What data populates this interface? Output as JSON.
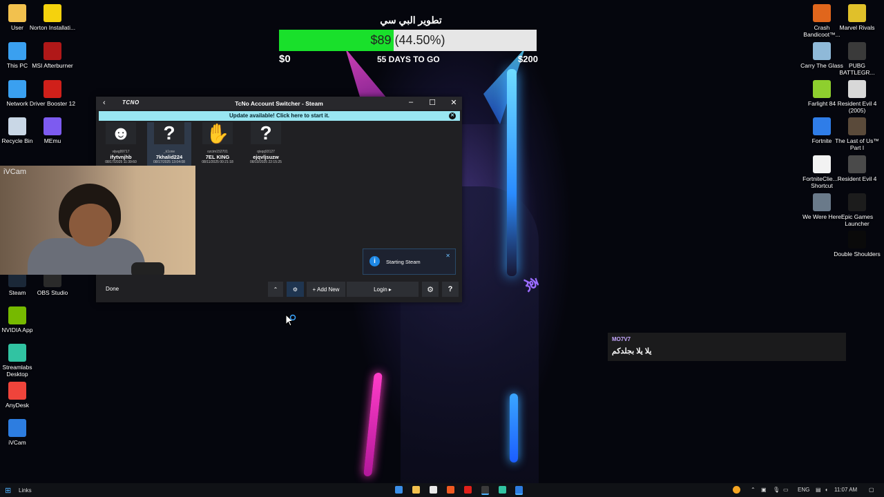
{
  "desktop_left": [
    {
      "label": "User",
      "icon": "folder-icon",
      "color": "#f2c14e"
    },
    {
      "label": "Norton Installati...",
      "icon": "norton-icon",
      "color": "#f5d20d"
    },
    {
      "label": "This PC",
      "icon": "monitor-icon",
      "color": "#3aa0f0"
    },
    {
      "label": "MSI Afterburner",
      "icon": "msi-afterburner-icon",
      "color": "#b01818"
    },
    {
      "label": "Network",
      "icon": "network-icon",
      "color": "#3aa0f0"
    },
    {
      "label": "Driver Booster 12",
      "icon": "driver-booster-icon",
      "color": "#d0201a"
    },
    {
      "label": "Recycle Bin",
      "icon": "recycle-bin-icon",
      "color": "#c9d7e6"
    },
    {
      "label": "MEmu",
      "icon": "memu-icon",
      "color": "#7d5bf0"
    },
    {
      "label": "Steam",
      "icon": "steam-icon",
      "color": "#1b2838"
    },
    {
      "label": "OBS Studio",
      "icon": "obs-icon",
      "color": "#2a2a2a"
    },
    {
      "label": "NVIDIA App",
      "icon": "nvidia-icon",
      "color": "#76b900"
    },
    {
      "label": "Streamlabs Desktop",
      "icon": "streamlabs-icon",
      "color": "#31c3a2"
    },
    {
      "label": "AnyDesk",
      "icon": "anydesk-icon",
      "color": "#ef443b"
    },
    {
      "label": "iVCam",
      "icon": "ivcam-icon",
      "color": "#2d7de0"
    }
  ],
  "desktop_right": [
    {
      "label": "Crash Bandicoot™...",
      "icon": "crash-bandicoot-icon",
      "color": "#e0661c"
    },
    {
      "label": "Marvel Rivals",
      "icon": "marvel-rivals-icon",
      "color": "#e0c02a"
    },
    {
      "label": "Carry The Glass",
      "icon": "carry-the-glass-icon",
      "color": "#8fb9d8"
    },
    {
      "label": "PUBG BATTLEGR...",
      "icon": "pubg-icon",
      "color": "#3a3a3a"
    },
    {
      "label": "Farlight 84",
      "icon": "farlight-icon",
      "color": "#8ecf2e"
    },
    {
      "label": "Resident Evil 4 (2005)",
      "icon": "resident-evil-icon",
      "color": "#d8d8d8"
    },
    {
      "label": "Fortnite",
      "icon": "fortnite-icon",
      "color": "#2f7de8"
    },
    {
      "label": "The Last of Us™ Part I",
      "icon": "last-of-us-icon",
      "color": "#5a4a3a"
    },
    {
      "label": "FortniteClie... - Shortcut",
      "icon": "file-icon",
      "color": "#f2f2f2"
    },
    {
      "label": "Resident Evil 4",
      "icon": "resident-evil-icon",
      "color": "#4a4a4a"
    },
    {
      "label": "We Were Here",
      "icon": "we-were-here-icon",
      "color": "#6a7a8a"
    },
    {
      "label": "Epic Games Launcher",
      "icon": "epic-games-icon",
      "color": "#1c1c1c"
    },
    {
      "label": "Double Shoulders",
      "icon": "double-shoulders-icon",
      "color": "#0a0a0a"
    }
  ],
  "goal": {
    "title": "تطوير البي سي",
    "amount_text": "$89 (44.50%)",
    "progress_percent": 44.5,
    "min_label": "$0",
    "days_label": "55 DAYS TO GO",
    "max_label": "$200"
  },
  "tcno": {
    "title": "TcNo Account Switcher - Steam",
    "logo": "TCNO",
    "update_banner": "Update available! Click here to start it.",
    "accounts": [
      {
        "small": "vijwg99717",
        "name": "ifytvnjhb",
        "date": "08/17/2025 11:39:60",
        "avatar": "person-avatar"
      },
      {
        "small": "_k1one",
        "name": "7khalid224",
        "date": "08/17/2025 13:04:08",
        "avatar": "question-avatar",
        "selected": true
      },
      {
        "small": "ozcim152701",
        "name": "7EL KING",
        "date": "08/11/2025 00:21:18",
        "avatar": "hand-avatar"
      },
      {
        "small": "qisqq93127",
        "name": "ejqvljsuzw",
        "date": "08/10/2025 22:15:25",
        "avatar": "question-avatar"
      }
    ],
    "toast_text": "Starting Steam",
    "status": "Done",
    "add_new_label": "+ Add New",
    "login_label": "Login ▸"
  },
  "webcam_label": "iVCam",
  "chat": {
    "user": "MO7V7",
    "message": "يلا يلا بجلدكم"
  },
  "taskbar": {
    "links_label": "Links",
    "language": "ENG",
    "time": "11:07 AM"
  }
}
